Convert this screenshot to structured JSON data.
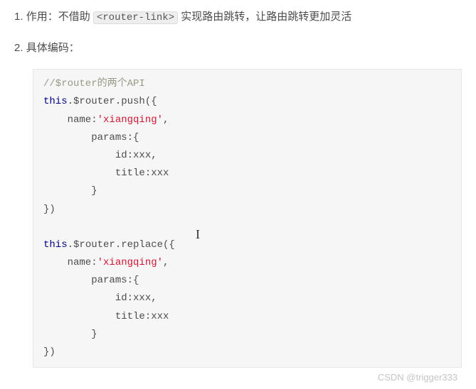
{
  "item1": {
    "num": "1.",
    "label": "作用：不借助",
    "code": "<router-link>",
    "tail": "实现路由跳转，让路由跳转更加灵活"
  },
  "item2": {
    "num": "2.",
    "label": "具体编码："
  },
  "code": {
    "comment": "//$router的两个API",
    "l2a": "this",
    "l2b": ".$router.push({",
    "l3a": "    name:",
    "l3s": "'xiangqing'",
    "l3b": ",",
    "l4": "        params:{",
    "l5": "            id:xxx,",
    "l6": "            title:xxx",
    "l7": "        }",
    "l8": "})",
    "l10a": "this",
    "l10b": ".$router.replace({",
    "l11a": "    name:",
    "l11s": "'xiangqing'",
    "l11b": ",",
    "l12": "        params:{",
    "l13": "            id:xxx,",
    "l14": "            title:xxx",
    "l15": "        }",
    "l16": "})"
  },
  "watermark": "CSDN @trigger333"
}
